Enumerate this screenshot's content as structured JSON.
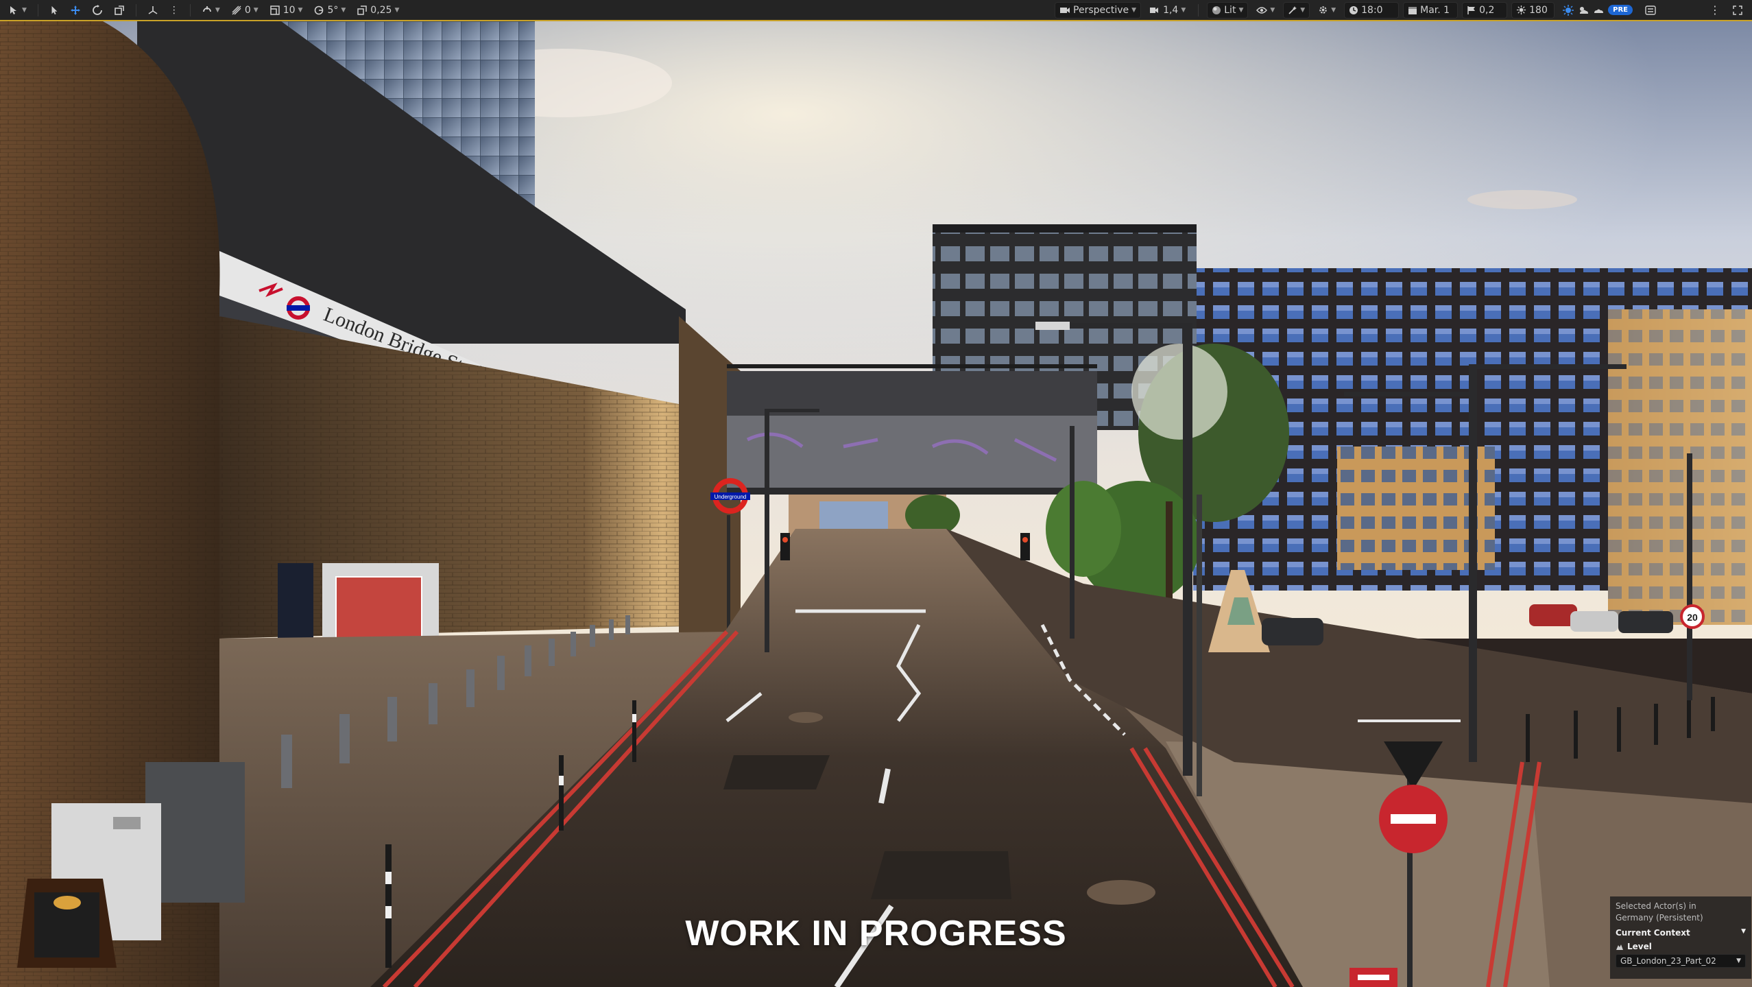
{
  "toolbar": {
    "transform_tools": [
      "select-icon",
      "move-icon",
      "rotate-icon",
      "scale-icon"
    ],
    "snap_rotation": "0",
    "snap_grid": "10",
    "snap_angle": "5°",
    "snap_scale": "0,25",
    "view_mode": "Perspective",
    "camera_speed": "1,4",
    "lighting_mode": "Lit",
    "time_value": "18:0",
    "date_value": "Mar. 1",
    "distance_value": "0,2",
    "sun_value": "180"
  },
  "viewport": {
    "overlay_text": "WORK IN PROGRESS",
    "sign_station": "London Bridge Station",
    "sign_underground": "Underground",
    "speed_sign": "20"
  },
  "info_panel": {
    "line1": "Selected Actor(s) in",
    "line2": "Germany (Persistent)",
    "context_label": "Current Context",
    "level_label": "Level",
    "level_value": "GB_London_23_Part_02"
  },
  "colors": {
    "toolbar_bg": "#242424",
    "accent": "#c9a227",
    "blue": "#1d67d4"
  }
}
